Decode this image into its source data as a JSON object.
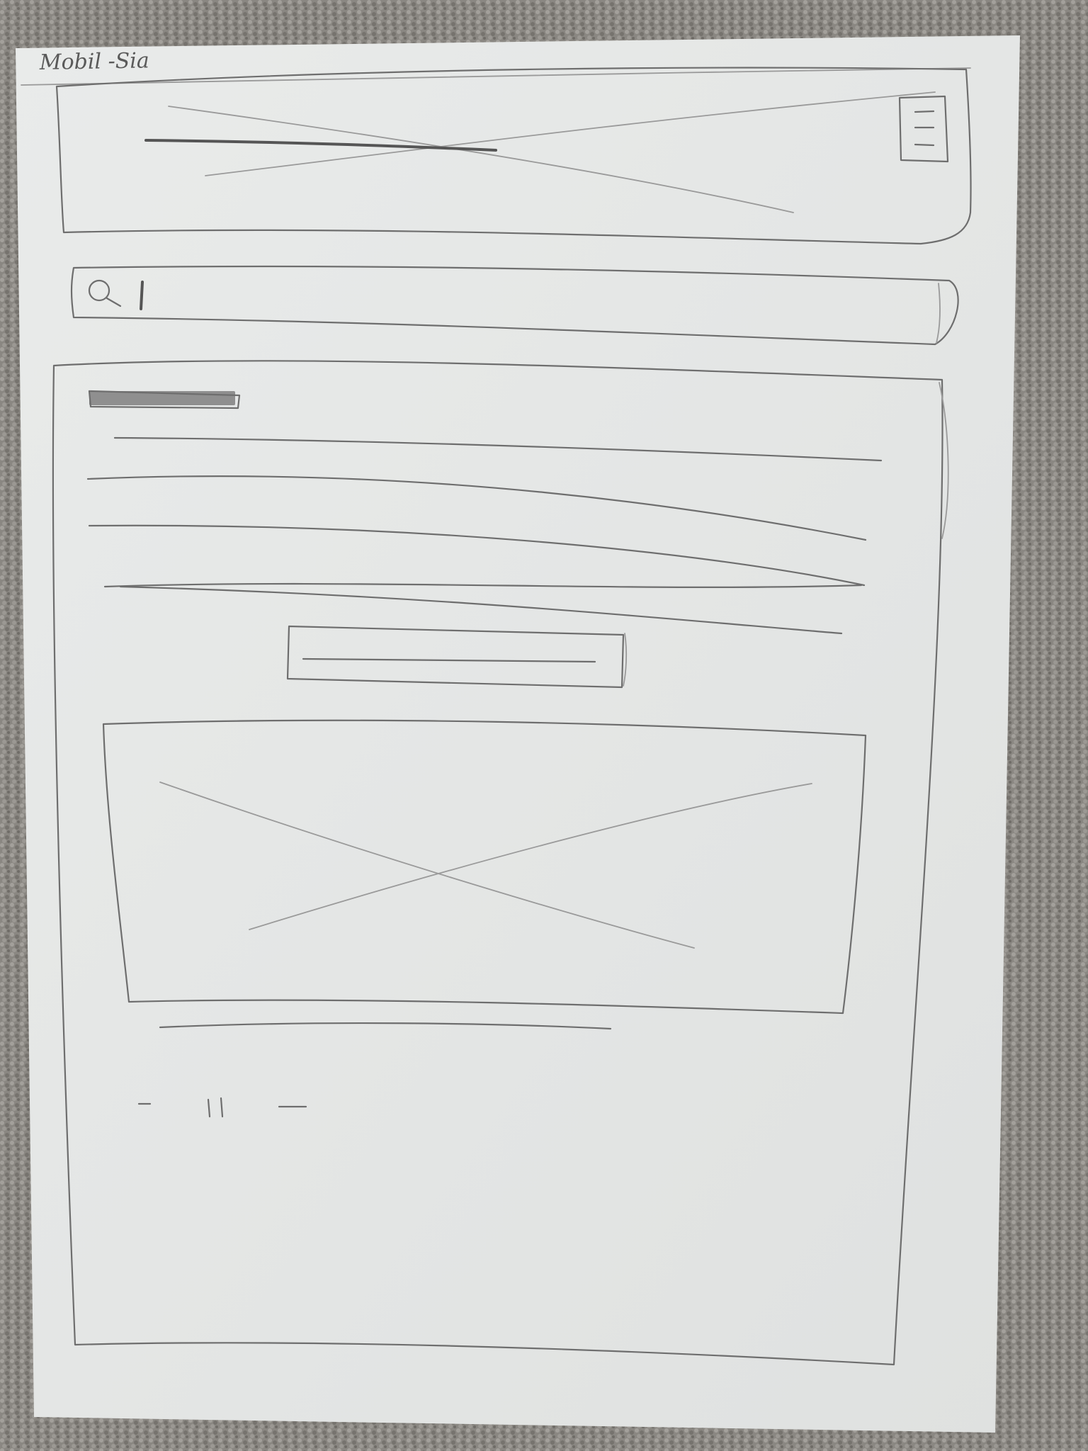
{
  "sketch": {
    "title": "Mobil -Sia",
    "colors": {
      "carpet": "#8d8a85",
      "paper": "#e6e8e7",
      "pencil": "#6e6e6e"
    },
    "header": {
      "contains": [
        "image-placeholder",
        "title-line",
        "hamburger-menu-icon"
      ]
    },
    "search": {
      "icon": "search-icon"
    },
    "content": {
      "paragraph_line_count": 5,
      "image_placeholder": "image-placeholder-icon",
      "pagination": {
        "marks": [
          "–",
          "| |",
          "—"
        ]
      }
    }
  }
}
